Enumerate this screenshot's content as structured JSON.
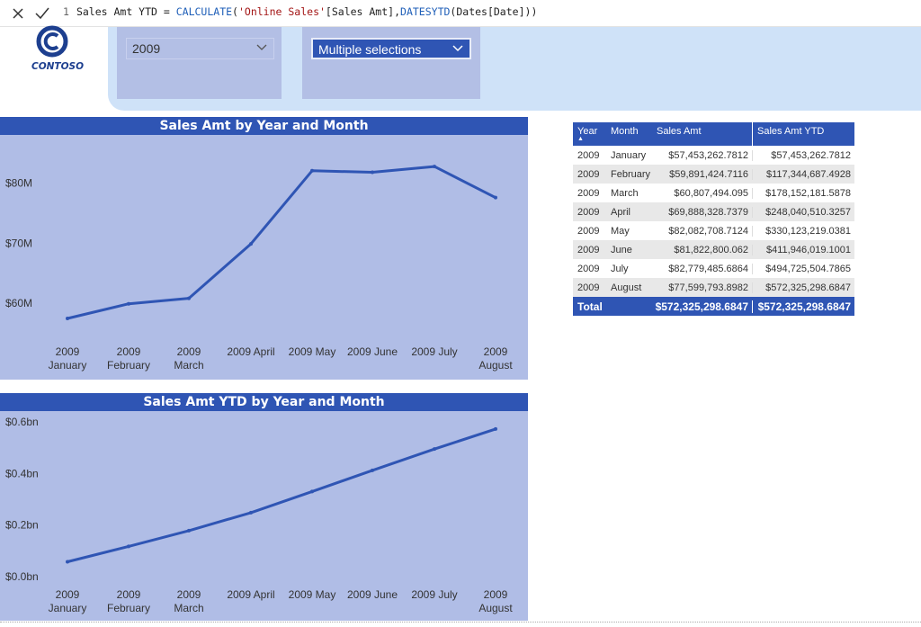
{
  "formula_bar": {
    "cancel_icon": "close-icon",
    "commit_icon": "check-icon",
    "line_number": "1",
    "measure_name": "Sales Amt YTD",
    "operator": " = ",
    "fn_calculate": "CALCULATE",
    "open_paren": "(",
    "table_ref": "'Online Sales'",
    "column_ref": "[Sales Amt]",
    "comma": ",",
    "fn_datesytd": "DATESYTD",
    "dates_ref": "(Dates[Date])",
    "close_paren": ")"
  },
  "logo": {
    "text": "CONTOSO",
    "icon": "contoso-logo-icon"
  },
  "slicers": {
    "year": {
      "value": "2009",
      "chevron": "chevron-down-icon"
    },
    "month": {
      "value": "Multiple selections",
      "chevron": "chevron-down-icon"
    }
  },
  "colors": {
    "accent": "#2f55b4",
    "chart_bg": "#b0bde6",
    "line": "#2f55b4",
    "band": "#cfe2f8"
  },
  "chart_data": [
    {
      "type": "line",
      "title": "Sales Amt by Year and Month",
      "categories": [
        "2009 January",
        "2009 February",
        "2009 March",
        "2009 April",
        "2009 May",
        "2009 June",
        "2009 July",
        "2009 August"
      ],
      "category_lines": [
        [
          "2009",
          "January"
        ],
        [
          "2009",
          "February"
        ],
        [
          "2009",
          "March"
        ],
        [
          "2009 April"
        ],
        [
          "2009 May"
        ],
        [
          "2009 June"
        ],
        [
          "2009 July"
        ],
        [
          "2009",
          "August"
        ]
      ],
      "values": [
        57453262.7812,
        59891424.7116,
        60807494.095,
        69888328.7379,
        82082708.7124,
        81822800.062,
        82779485.6864,
        77599793.8982
      ],
      "yticks": [
        60000000,
        70000000,
        80000000
      ],
      "ytick_labels": [
        "$60M",
        "$70M",
        "$80M"
      ],
      "ylim": [
        54000000,
        84000000
      ],
      "grid": false
    },
    {
      "type": "line",
      "title": "Sales Amt YTD by Year and Month",
      "categories": [
        "2009 January",
        "2009 February",
        "2009 March",
        "2009 April",
        "2009 May",
        "2009 June",
        "2009 July",
        "2009 August"
      ],
      "category_lines": [
        [
          "2009",
          "January"
        ],
        [
          "2009",
          "February"
        ],
        [
          "2009",
          "March"
        ],
        [
          "2009 April"
        ],
        [
          "2009 May"
        ],
        [
          "2009 June"
        ],
        [
          "2009 July"
        ],
        [
          "2009",
          "August"
        ]
      ],
      "values": [
        57453262.7812,
        117344687.4928,
        178152181.5878,
        248040510.3257,
        330123219.0381,
        411946019.1001,
        494725504.7865,
        572325298.6847
      ],
      "yticks": [
        0,
        200000000,
        400000000,
        600000000
      ],
      "ytick_labels": [
        "$0.0bn",
        "$0.2bn",
        "$0.4bn",
        "$0.6bn"
      ],
      "ylim": [
        0,
        600000000
      ],
      "grid": false
    }
  ],
  "table": {
    "headers": {
      "year": "Year",
      "month": "Month",
      "sales": "Sales Amt",
      "ytd": "Sales Amt YTD",
      "sort_icon": "▲"
    },
    "rows": [
      {
        "year": "2009",
        "month": "January",
        "sales": "$57,453,262.7812",
        "ytd": "$57,453,262.7812"
      },
      {
        "year": "2009",
        "month": "February",
        "sales": "$59,891,424.7116",
        "ytd": "$117,344,687.4928"
      },
      {
        "year": "2009",
        "month": "March",
        "sales": "$60,807,494.095",
        "ytd": "$178,152,181.5878"
      },
      {
        "year": "2009",
        "month": "April",
        "sales": "$69,888,328.7379",
        "ytd": "$248,040,510.3257"
      },
      {
        "year": "2009",
        "month": "May",
        "sales": "$82,082,708.7124",
        "ytd": "$330,123,219.0381"
      },
      {
        "year": "2009",
        "month": "June",
        "sales": "$81,822,800.062",
        "ytd": "$411,946,019.1001"
      },
      {
        "year": "2009",
        "month": "July",
        "sales": "$82,779,485.6864",
        "ytd": "$494,725,504.7865"
      },
      {
        "year": "2009",
        "month": "August",
        "sales": "$77,599,793.8982",
        "ytd": "$572,325,298.6847"
      }
    ],
    "total": {
      "label": "Total",
      "sales": "$572,325,298.6847",
      "ytd": "$572,325,298.6847"
    }
  }
}
